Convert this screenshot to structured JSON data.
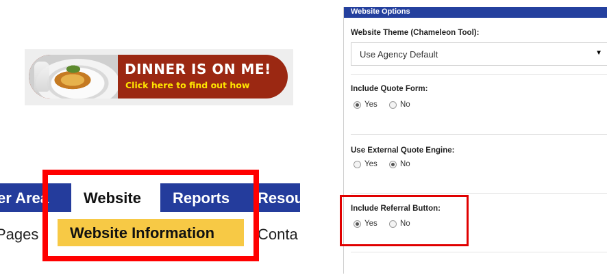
{
  "banner": {
    "title": "DINNER IS ON ME!",
    "subtitle": "Click here to find out how"
  },
  "nav": {
    "partial_left": "er Area",
    "active_tab": "Website",
    "reports": "Reports",
    "partial_right": "Resou"
  },
  "subnav": {
    "partial_left": "Pages",
    "active": "Website Information",
    "partial_right": "Conta"
  },
  "panel": {
    "header": "Website Options",
    "theme": {
      "label": "Website Theme (Chameleon Tool):",
      "value": "Use Agency Default"
    },
    "quote_form": {
      "label": "Include Quote Form:",
      "yes": "Yes",
      "no": "No",
      "selected": "Yes"
    },
    "external_quote": {
      "label": "Use External Quote Engine:",
      "yes": "Yes",
      "no": "No",
      "selected": "No"
    },
    "referral": {
      "label": "Include Referral Button:",
      "yes": "Yes",
      "no": "No",
      "selected": "Yes"
    }
  },
  "colors": {
    "nav_bg": "#243c9c",
    "subnav_active": "#f7c945",
    "banner_bg": "#9b2812",
    "banner_sub": "#ffe600",
    "highlight": "#ff0000"
  }
}
